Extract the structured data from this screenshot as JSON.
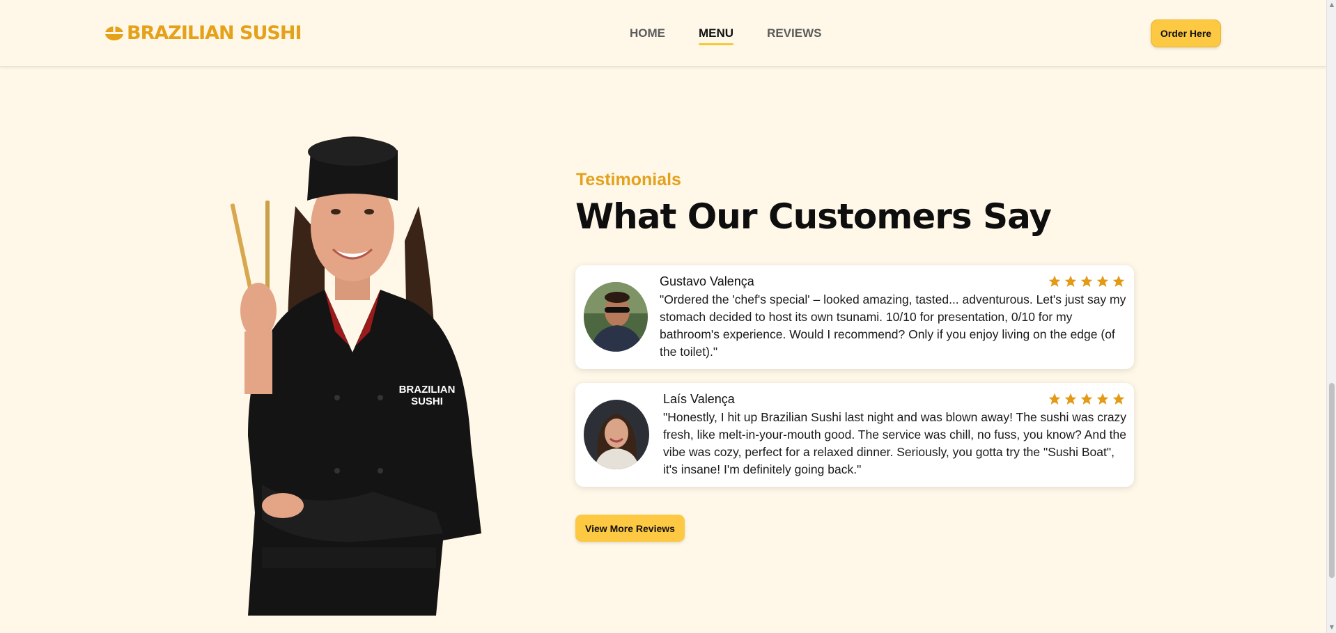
{
  "brand": {
    "name": "BRAZILIAN SUSHI",
    "accent": "#e3a11e",
    "button_color": "#fdc842",
    "background": "#fff8e8"
  },
  "nav": {
    "items": [
      {
        "label": "HOME",
        "active": false
      },
      {
        "label": "MENU",
        "active": true
      },
      {
        "label": "REVIEWS",
        "active": false
      }
    ],
    "order_label": "Order Here"
  },
  "hero": {
    "chef_jacket_text": "BRAZILIAN SUSHI"
  },
  "testimonials": {
    "eyebrow": "Testimonials",
    "title": "What Our Customers Say",
    "reviews": [
      {
        "name": "Gustavo Valença",
        "rating": 5,
        "text": "\"Ordered the 'chef's special' – looked amazing, tasted... adventurous. Let's just say my stomach decided to host its own tsunami. 10/10 for presentation, 0/10 for my bathroom's experience. Would I recommend? Only if you enjoy living on the edge (of the toilet).\""
      },
      {
        "name": "Laís Valença",
        "rating": 5,
        "text": "\"Honestly, I hit up Brazilian Sushi last night and was blown away! The sushi was crazy fresh, like melt-in-your-mouth good. The service was chill, no fuss, you know? And the vibe was cozy, perfect for a relaxed dinner. Seriously, you gotta try the \"Sushi Boat\", it's insane! I'm definitely going back.\""
      }
    ],
    "more_label": "View More Reviews"
  }
}
